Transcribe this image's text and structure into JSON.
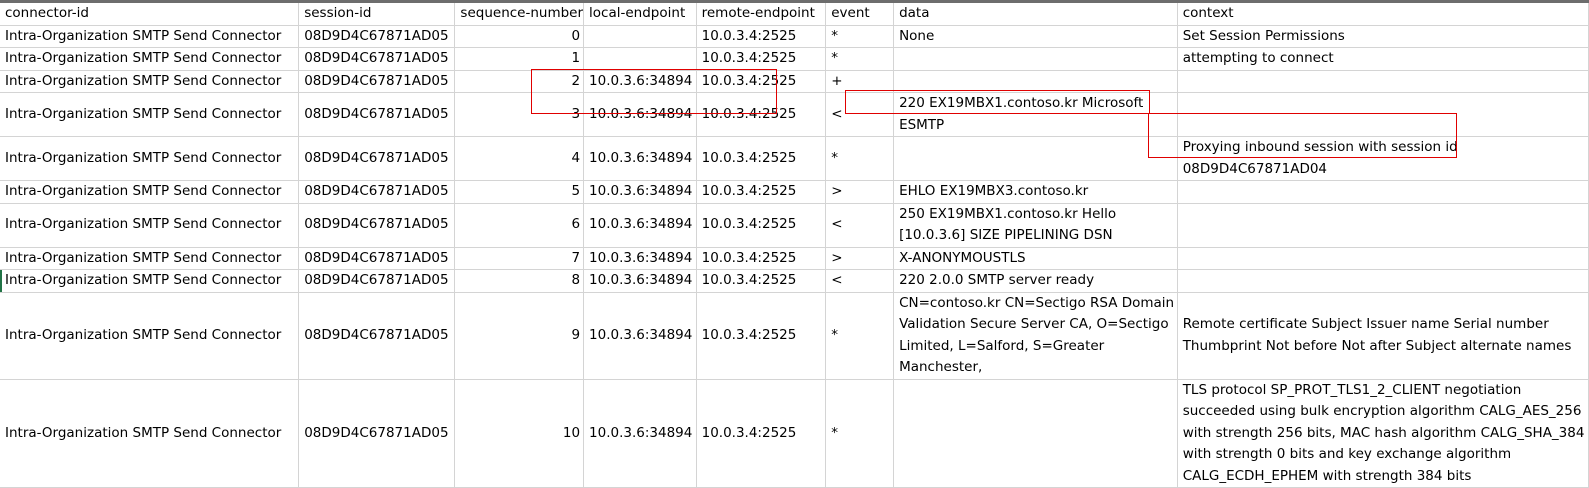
{
  "sheet": {
    "columns": [
      "connector-id",
      "session-id",
      "sequence-number",
      "local-endpoint",
      "remote-endpoint",
      "event",
      "data",
      "context"
    ],
    "rows": [
      {
        "connector_id": "Intra-Organization SMTP Send Connector",
        "session_id": "08D9D4C67871AD05",
        "seq": "0",
        "local": "",
        "remote": "10.0.3.4:2525",
        "event": "*",
        "data": "None",
        "context": "Set Session Permissions"
      },
      {
        "connector_id": "Intra-Organization SMTP Send Connector",
        "session_id": "08D9D4C67871AD05",
        "seq": "1",
        "local": "",
        "remote": "10.0.3.4:2525",
        "event": "*",
        "data": "",
        "context": "attempting to connect"
      },
      {
        "connector_id": "Intra-Organization SMTP Send Connector",
        "session_id": "08D9D4C67871AD05",
        "seq": "2",
        "local": "10.0.3.6:34894",
        "remote": "10.0.3.4:2525",
        "event": "+",
        "data": "",
        "context": ""
      },
      {
        "connector_id": "Intra-Organization SMTP Send Connector",
        "session_id": "08D9D4C67871AD05",
        "seq": "3",
        "local": "10.0.3.6:34894",
        "remote": "10.0.3.4:2525",
        "event": "<",
        "data": "220 EX19MBX1.contoso.kr Microsoft ESMTP",
        "context": ""
      },
      {
        "connector_id": "Intra-Organization SMTP Send Connector",
        "session_id": "08D9D4C67871AD05",
        "seq": "4",
        "local": "10.0.3.6:34894",
        "remote": "10.0.3.4:2525",
        "event": "*",
        "data": "",
        "context": "Proxying inbound session with session id 08D9D4C67871AD04"
      },
      {
        "connector_id": "Intra-Organization SMTP Send Connector",
        "session_id": "08D9D4C67871AD05",
        "seq": "5",
        "local": "10.0.3.6:34894",
        "remote": "10.0.3.4:2525",
        "event": ">",
        "data": "EHLO EX19MBX3.contoso.kr",
        "context": ""
      },
      {
        "connector_id": "Intra-Organization SMTP Send Connector",
        "session_id": "08D9D4C67871AD05",
        "seq": "6",
        "local": "10.0.3.6:34894",
        "remote": "10.0.3.4:2525",
        "event": "<",
        "data": "250  EX19MBX1.contoso.kr Hello [10.0.3.6] SIZE PIPELINING DSN",
        "context": ""
      },
      {
        "connector_id": "Intra-Organization SMTP Send Connector",
        "session_id": "08D9D4C67871AD05",
        "seq": "7",
        "local": "10.0.3.6:34894",
        "remote": "10.0.3.4:2525",
        "event": ">",
        "data": "X-ANONYMOUSTLS",
        "context": ""
      },
      {
        "connector_id": "Intra-Organization SMTP Send Connector",
        "session_id": "08D9D4C67871AD05",
        "seq": "8",
        "local": "10.0.3.6:34894",
        "remote": "10.0.3.4:2525",
        "event": "<",
        "data": "220 2.0.0 SMTP server ready",
        "context": ""
      },
      {
        "connector_id": "Intra-Organization SMTP Send Connector",
        "session_id": "08D9D4C67871AD05",
        "seq": "9",
        "local": "10.0.3.6:34894",
        "remote": "10.0.3.4:2525",
        "event": "*",
        "data": " CN=contoso.kr CN=Sectigo RSA Domain Validation Secure Server CA, O=Sectigo Limited, L=Salford, S=Greater Manchester,",
        "context": "Remote certificate Subject Issuer name Serial number Thumbprint Not before Not after Subject alternate names"
      },
      {
        "connector_id": "Intra-Organization SMTP Send Connector",
        "session_id": "08D9D4C67871AD05",
        "seq": "10",
        "local": "10.0.3.6:34894",
        "remote": "10.0.3.4:2525",
        "event": "*",
        "data": "",
        "context": "TLS protocol SP_PROT_TLS1_2_CLIENT negotiation succeeded using bulk encryption algorithm CALG_AES_256 with strength 256 bits, MAC hash algorithm CALG_SHA_384 with strength 0 bits and key exchange algorithm CALG_ECDH_EPHEM with strength 384 bits"
      }
    ],
    "highlight_color": "#e00000",
    "grid_color": "#d4d4d4"
  }
}
